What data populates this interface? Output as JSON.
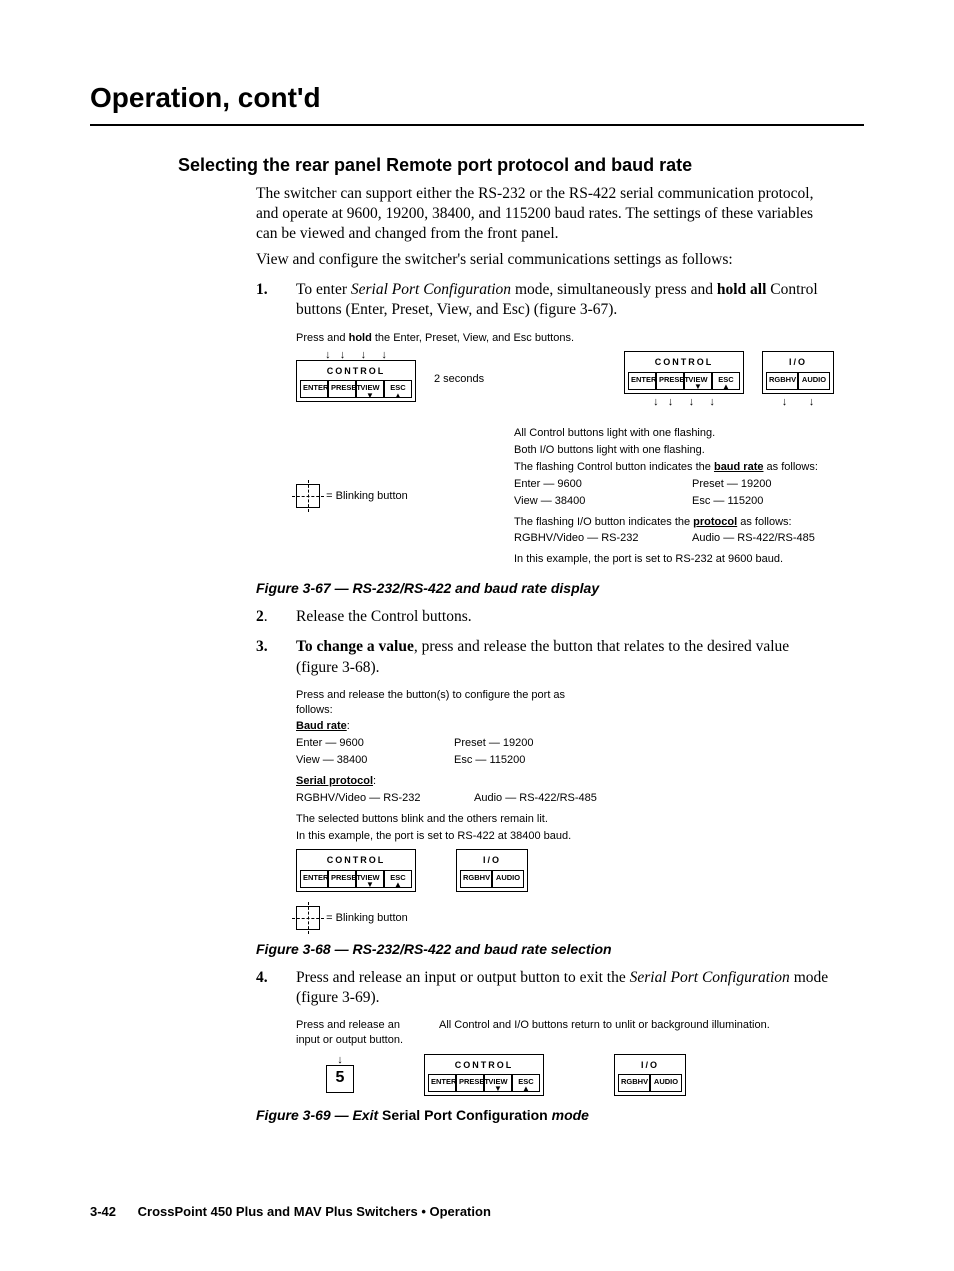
{
  "header": {
    "title": "Operation, cont'd"
  },
  "section": {
    "title": "Selecting the rear panel Remote port protocol and baud rate"
  },
  "intro": {
    "p1": "The switcher can support either the RS-232 or the RS-422 serial communication protocol, and operate at 9600, 19200, 38400, and 115200 baud rates.  The settings of these variables can be viewed and changed from the front panel.",
    "p2": "View and configure the switcher's serial communications settings as follows:"
  },
  "steps": {
    "s1": {
      "num": "1.",
      "pre": "To enter ",
      "ital": "Serial Port Configuration",
      "post": " mode, simultaneously press and ",
      "holdall": "hold all",
      "tail": " Control buttons (Enter, Preset, View, and Esc) (figure 3-67)."
    },
    "s2": {
      "num": "2.",
      "txt": "Release the Control buttons."
    },
    "s3": {
      "num": "3.",
      "lead": "To change a value",
      "txt": ", press and release the button that relates to the desired value (figure 3-68)."
    },
    "s4": {
      "num": "4.",
      "pre": "Press and release an input or output button to exit the ",
      "ital": "Serial Port Configuration",
      "post": " mode (figure 3-69)."
    }
  },
  "fig67": {
    "instr": "Press and hold the Enter, Preset, View, and Esc buttons.",
    "hold_part": "hold",
    "two_seconds": "2 seconds",
    "control_label": "CONTROL",
    "io_label": "I/O",
    "btns": {
      "enter": "ENTER",
      "preset": "PRESET",
      "view": "VIEW",
      "esc": "ESC",
      "rgbhv": "RGBHV",
      "audio": "AUDIO"
    },
    "notes": {
      "a": "All Control buttons light with one flashing.",
      "b": "Both I/O buttons light with one flashing.",
      "c_pre": "The flashing Control button indicates the ",
      "c_bold": "baud rate",
      "c_post": " as follows:",
      "enter": "Enter — 9600",
      "preset": "Preset — 19200",
      "view": "View — 38400",
      "esc": "Esc — 115200",
      "d_pre": "The flashing I/O button indicates the ",
      "d_bold": "protocol",
      "d_post": " as follows:",
      "rgbhv": "RGBHV/Video — RS-232",
      "audio": "Audio — RS-422/RS-485",
      "ex": "In this example, the port is set to RS-232 at 9600 baud."
    },
    "legend": "= Blinking button",
    "caption": "Figure 3-67 — RS-232/RS-422 and baud rate display"
  },
  "fig68": {
    "instr": "Press and release the button(s) to configure the port as follows:",
    "baud_label": "Baud rate",
    "enter": "Enter — 9600",
    "preset": "Preset — 19200",
    "view": "View — 38400",
    "esc": "Esc — 115200",
    "proto_label": "Serial protocol",
    "rgbhv": "RGBHV/Video — RS-232",
    "audio": "Audio — RS-422/RS-485",
    "note1": "The selected buttons blink and the others remain lit.",
    "note2": "In this example, the port is set to RS-422 at 38400 baud.",
    "legend": "= Blinking button",
    "caption": "Figure 3-68 — RS-232/RS-422 and baud rate selection"
  },
  "fig69": {
    "instr": "Press and release an input or output button.",
    "btn5": "5",
    "note": "All Control and I/O buttons return to unlit or background illumination.",
    "caption_pre": "Figure 3-69 — Exit ",
    "caption_bold": "Serial Port Configuration",
    "caption_post": " mode"
  },
  "footer": {
    "page": "3-42",
    "text": "CrossPoint 450 Plus and MAV Plus Switchers • Operation"
  }
}
